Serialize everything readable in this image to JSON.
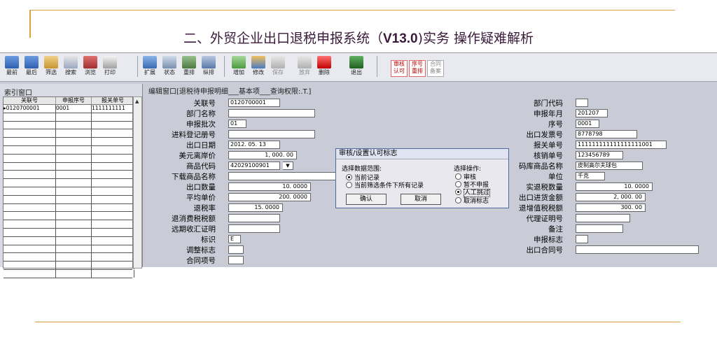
{
  "slide_title_pre": "二、外贸企业出口退税申报系统（",
  "slide_title_ver": "V13.0",
  "slide_title_post": ")实务 操作疑难解析",
  "toolbar": {
    "buttons": [
      "最前",
      "最后",
      "筛选",
      "搜索",
      "浏览",
      "打印",
      "扩展",
      "状态",
      "重排",
      "纵排",
      "增加",
      "修改",
      "保存",
      "放弃",
      "删除",
      "退出"
    ],
    "tag_review": "审核认可",
    "tag_reorder": "序号重排",
    "tag_contract": "合同备案"
  },
  "index_panel": {
    "title": "索引窗口",
    "columns": [
      "关联号",
      "申报序号",
      "报关单号"
    ],
    "rows": [
      [
        "0120700001",
        "0001",
        "1111111111"
      ]
    ]
  },
  "edit": {
    "title": "编辑窗口[退税待申报明细___基本项___查询权限:.T.]",
    "left_labels": {
      "guanlian": "关联号",
      "bumen_name": "部门名称",
      "pici": "申报批次",
      "jinhuo": "进料登记册号",
      "chukou_date": "出口日期",
      "usd": "美元离岸价",
      "code": "商品代码",
      "dl_name": "下载商品名称",
      "qty": "出口数量",
      "price": "平均单价",
      "rate": "退税率",
      "xiaofei": "退消费税税额",
      "yuanqi": "远期收汇证明",
      "biaoshi": "标识",
      "tiaozheng": "调整标志",
      "hetong": "合同项号"
    },
    "left_values": {
      "guanlian": "0120700001",
      "pici": "01",
      "chukou_date": "2012. 05. 13",
      "usd": "1, 000. 00",
      "code": "42029100901",
      "qty": "10. 0000",
      "price": "200. 0000",
      "rate": "15. 0000",
      "biaoshi": "E"
    },
    "right_labels": {
      "bumen_code": "部门代码",
      "ym": "申报年月",
      "xuhao": "序号",
      "fapiao": "出口发票号",
      "baoguan": "报关单号",
      "hexiao": "核销单号",
      "ku_name": "码库商品名称",
      "danwei": "单位",
      "shitui": "实退税数量",
      "jinhuo_amt": "出口进货金额",
      "vat": "退增值税税额",
      "daili": "代理证明号",
      "beizhu": "备注",
      "shenbao": "申报标志",
      "hetong_no": "出口合同号"
    },
    "right_values": {
      "ym": "201207",
      "xuhao": "0001",
      "fapiao": "8778798",
      "baoguan": "111111111111111111001",
      "hexiao": "123456789",
      "ku_name": "皮制高尔夫球包",
      "danwei": "千克",
      "shitui": "10. 0000",
      "jinhuo_amt": "2, 000. 00",
      "vat": "300. 00"
    }
  },
  "dialog": {
    "title": "审核/设置认可标志",
    "scope_label": "选择数据范围:",
    "scope_options": [
      "当前记录",
      "当前筛选条件下所有记录"
    ],
    "action_label": "选择操作:",
    "action_options": [
      "审核",
      "暂不申报",
      "人工挑过",
      "取消标志"
    ],
    "ok": "确认",
    "cancel": "取消"
  }
}
